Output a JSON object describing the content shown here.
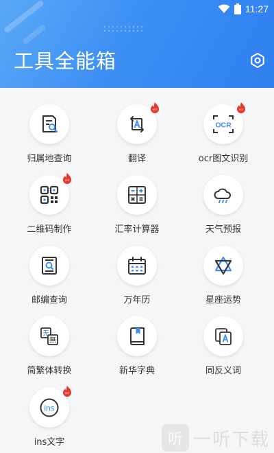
{
  "status": {
    "time": "11:27"
  },
  "header": {
    "title": "工具全能箱"
  },
  "tools": [
    {
      "label": "归属地查询",
      "hot": false,
      "icon": "location-search-icon"
    },
    {
      "label": "翻译",
      "hot": true,
      "icon": "translate-icon"
    },
    {
      "label": "ocr图文识别",
      "hot": true,
      "icon": "ocr-scan-icon",
      "icon_text": "OCR"
    },
    {
      "label": "二维码制作",
      "hot": true,
      "icon": "qr-code-icon"
    },
    {
      "label": "汇率计算器",
      "hot": false,
      "icon": "calculator-icon"
    },
    {
      "label": "天气预报",
      "hot": false,
      "icon": "weather-icon"
    },
    {
      "label": "邮编查询",
      "hot": false,
      "icon": "postcode-search-icon"
    },
    {
      "label": "万年历",
      "hot": false,
      "icon": "calendar-icon"
    },
    {
      "label": "星座运势",
      "hot": false,
      "icon": "star-icon"
    },
    {
      "label": "简繁体转换",
      "hot": false,
      "icon": "convert-icon",
      "icon_text_a": "无",
      "icon_text_b": "無"
    },
    {
      "label": "新华字典",
      "hot": false,
      "icon": "dictionary-icon"
    },
    {
      "label": "同反义词",
      "hot": false,
      "icon": "synonym-icon"
    },
    {
      "label": "ins文字",
      "hot": true,
      "icon": "ins-text-icon",
      "icon_text": "ins"
    }
  ],
  "watermark": {
    "logo": "听",
    "text": "一听下载"
  },
  "colors": {
    "accent": "#3d8ff3",
    "hot": "#e8382e",
    "icon_stroke": "#333333"
  }
}
